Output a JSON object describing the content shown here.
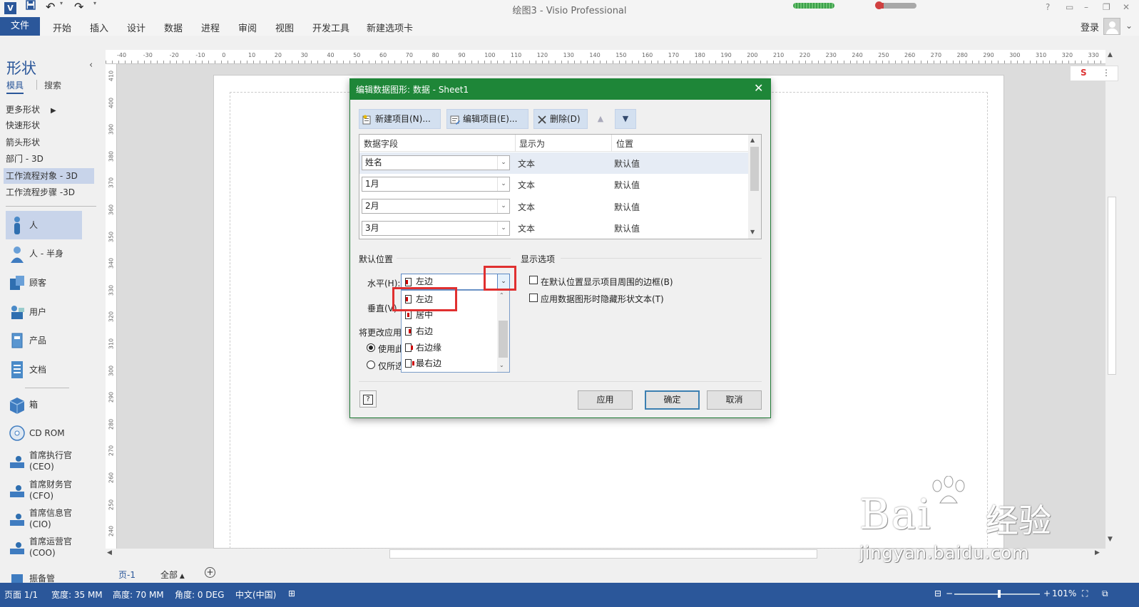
{
  "window": {
    "title": "绘图3 - Visio Professional",
    "app_badge": "V",
    "quick_access": {
      "undo": "↶",
      "redo": "↷"
    }
  },
  "ribbon": {
    "file": "文件",
    "tabs": [
      "开始",
      "插入",
      "设计",
      "数据",
      "进程",
      "审阅",
      "视图",
      "开发工具",
      "新建选项卡"
    ],
    "sign_in": "登录"
  },
  "shapes_pane": {
    "title": "形状",
    "tabs": {
      "stencils": "模具",
      "search": "搜索"
    },
    "stencils": [
      "更多形状",
      "快速形状",
      "箭头形状",
      "部门 - 3D",
      "工作流程对象 - 3D",
      "工作流程步骤 -3D"
    ],
    "selected_stencil": "工作流程对象 - 3D",
    "shapes": [
      {
        "label": "人"
      },
      {
        "label": "人 - 半身"
      },
      {
        "label": "顾客"
      },
      {
        "label": "用户"
      },
      {
        "label": "产品"
      },
      {
        "label": "文档"
      },
      {
        "label": "箱"
      },
      {
        "label": "CD ROM"
      },
      {
        "label": "首席执行官\n(CEO)"
      },
      {
        "label": "首席财务官\n(CFO)"
      },
      {
        "label": "首席信息官\n(CIO)"
      },
      {
        "label": "首席运营官\n(COO)"
      },
      {
        "label": "振备管"
      }
    ]
  },
  "ruler": {
    "top_labels": [
      "-40",
      "-30",
      "-20",
      "-10",
      "0",
      "10",
      "20",
      "30",
      "40",
      "50",
      "60",
      "70",
      "80",
      "90",
      "100",
      "110",
      "120",
      "130",
      "140",
      "150",
      "160",
      "170",
      "180",
      "190",
      "200",
      "210",
      "220",
      "230",
      "240",
      "250",
      "260",
      "270",
      "280",
      "290",
      "300",
      "310",
      "320",
      "330"
    ],
    "left_labels": [
      "410",
      "400",
      "390",
      "380",
      "370",
      "360",
      "350",
      "340",
      "330",
      "320",
      "310",
      "300",
      "290",
      "280",
      "270",
      "260",
      "250",
      "240"
    ]
  },
  "page_tabs": {
    "current": "页-1",
    "all": "全部",
    "add": "+"
  },
  "status": {
    "page": "页面 1/1",
    "width": "宽度: 35 MM",
    "height": "高度: 70 MM",
    "angle": "角度: 0 DEG",
    "lang": "中文(中国)",
    "zoom": "101%"
  },
  "dialog": {
    "title": "编辑数据图形: 数据 - Sheet1",
    "toolbar": {
      "new": "新建项目(N)...",
      "edit": "编辑项目(E)...",
      "delete": "删除(D)"
    },
    "columns": [
      "数据字段",
      "显示为",
      "位置"
    ],
    "rows": [
      {
        "field": "姓名",
        "display": "文本",
        "position": "默认值"
      },
      {
        "field": "1月",
        "display": "文本",
        "position": "默认值"
      },
      {
        "field": "2月",
        "display": "文本",
        "position": "默认值"
      },
      {
        "field": "3月",
        "display": "文本",
        "position": "默认值"
      }
    ],
    "default_position": {
      "group": "默认位置",
      "horizontal_label": "水平(H):",
      "horizontal_value": "左边",
      "vertical_label": "垂直(V)",
      "apply_label": "将更改应用",
      "radio_all": "使用此",
      "radio_selected": "仅所选"
    },
    "dropdown_options": [
      "左边",
      "居中",
      "右边",
      "右边缘",
      "最右边"
    ],
    "display_options": {
      "group": "显示选项",
      "border": "在默认位置显示项目周围的边框(B)",
      "hide_text": "应用数据图形时隐藏形状文本(T)"
    },
    "buttons": {
      "apply": "应用",
      "ok": "确定",
      "cancel": "取消",
      "help": "?"
    }
  },
  "watermark": {
    "brand": "Bai",
    "brand_cn": "经验",
    "url": "jingyan.baidu.com"
  },
  "ime": {
    "label": "S"
  }
}
